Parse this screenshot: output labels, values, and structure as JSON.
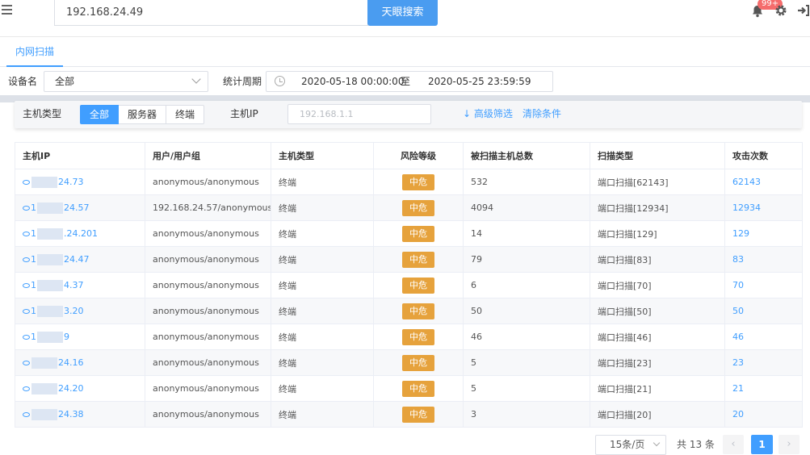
{
  "header": {
    "search_value": "192.168.24.49",
    "search_button": "天眼搜索",
    "notification_badge": "99+"
  },
  "tabs": [
    {
      "label": "内网扫描",
      "active": true
    }
  ],
  "filters": {
    "device_label": "设备名",
    "device_value": "全部",
    "period_label": "统计周期",
    "date_start": "2020-05-18 00:00:00",
    "date_sep": "至",
    "date_end": "2020-05-25 23:59:59",
    "host_type_label": "主机类型",
    "host_types": [
      "全部",
      "服务器",
      "终端"
    ],
    "host_ip_label": "主机IP",
    "host_ip_placeholder": "192.168.1.1",
    "advanced_filter": "高级筛选",
    "clear_filter": "清除条件"
  },
  "table": {
    "columns": [
      "主机IP",
      "用户/用户组",
      "主机类型",
      "风险等级",
      "被扫描主机总数",
      "扫描类型",
      "攻击次数"
    ],
    "rows": [
      {
        "ip_prefix": "",
        "ip_suffix": "24.73",
        "user": "anonymous/anonymous",
        "type": "终端",
        "risk": "中危",
        "total": "532",
        "scan": "端口扫描[62143]",
        "attacks": "62143"
      },
      {
        "ip_prefix": "1",
        "ip_suffix": "24.57",
        "user": "192.168.24.57/anonymous",
        "type": "终端",
        "risk": "中危",
        "total": "4094",
        "scan": "端口扫描[12934]",
        "attacks": "12934"
      },
      {
        "ip_prefix": "1",
        "ip_suffix": ".24.201",
        "user": "anonymous/anonymous",
        "type": "终端",
        "risk": "中危",
        "total": "14",
        "scan": "端口扫描[129]",
        "attacks": "129"
      },
      {
        "ip_prefix": "1",
        "ip_suffix": "24.47",
        "user": "anonymous/anonymous",
        "type": "终端",
        "risk": "中危",
        "total": "79",
        "scan": "端口扫描[83]",
        "attacks": "83"
      },
      {
        "ip_prefix": "1",
        "ip_suffix": "4.37",
        "user": "anonymous/anonymous",
        "type": "终端",
        "risk": "中危",
        "total": "6",
        "scan": "端口扫描[70]",
        "attacks": "70"
      },
      {
        "ip_prefix": "1",
        "ip_suffix": "3.20",
        "user": "anonymous/anonymous",
        "type": "终端",
        "risk": "中危",
        "total": "50",
        "scan": "端口扫描[50]",
        "attacks": "50"
      },
      {
        "ip_prefix": "1",
        "ip_suffix": "9",
        "user": "anonymous/anonymous",
        "type": "终端",
        "risk": "中危",
        "total": "46",
        "scan": "端口扫描[46]",
        "attacks": "46"
      },
      {
        "ip_prefix": "",
        "ip_suffix": "24.16",
        "user": "anonymous/anonymous",
        "type": "终端",
        "risk": "中危",
        "total": "5",
        "scan": "端口扫描[23]",
        "attacks": "23"
      },
      {
        "ip_prefix": "",
        "ip_suffix": "24.20",
        "user": "anonymous/anonymous",
        "type": "终端",
        "risk": "中危",
        "total": "5",
        "scan": "端口扫描[21]",
        "attacks": "21"
      },
      {
        "ip_prefix": "",
        "ip_suffix": "24.38",
        "user": "anonymous/anonymous",
        "type": "终端",
        "risk": "中危",
        "total": "3",
        "scan": "端口扫描[20]",
        "attacks": "20"
      }
    ]
  },
  "pagination": {
    "page_size": "15条/页",
    "total": "共 13 条",
    "current_page": "1",
    "prev": "‹",
    "next": "›"
  },
  "colors": {
    "primary": "#409eff",
    "search_button": "#4a9cf0",
    "risk_medium": "#e6a23c",
    "badge": "#f56c6c"
  }
}
